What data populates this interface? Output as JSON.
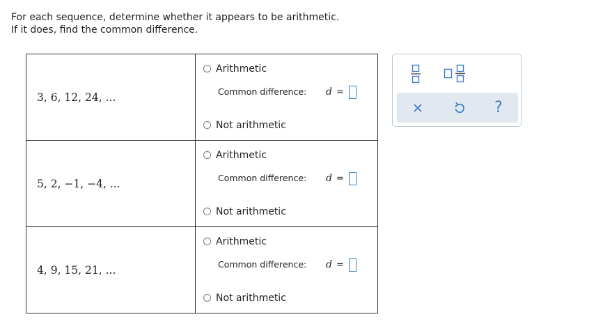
{
  "instructions": {
    "line1": "For each sequence, determine whether it appears to be arithmetic.",
    "line2": "If it does, find the common difference."
  },
  "rows": [
    {
      "sequence": "3, 6, 12, 24, ...",
      "option_arithmetic": "Arithmetic",
      "common_difference_label": "Common difference:",
      "variable": "d",
      "equals": "=",
      "answer_value": "",
      "option_not_arithmetic": "Not arithmetic"
    },
    {
      "sequence": "5, 2, −1, −4, ...",
      "option_arithmetic": "Arithmetic",
      "common_difference_label": "Common difference:",
      "variable": "d",
      "equals": "=",
      "answer_value": "",
      "option_not_arithmetic": "Not arithmetic"
    },
    {
      "sequence": "4, 9, 15, 21, ...",
      "option_arithmetic": "Arithmetic",
      "common_difference_label": "Common difference:",
      "variable": "d",
      "equals": "=",
      "answer_value": "",
      "option_not_arithmetic": "Not arithmetic"
    }
  ],
  "toolbar": {
    "icons": [
      "fraction-icon",
      "mixed-number-icon",
      "clear-icon",
      "undo-icon",
      "help-icon"
    ],
    "help_glyph": "?",
    "accent_color": "#3d7cc9",
    "bar_color": "#e1e8ef"
  }
}
